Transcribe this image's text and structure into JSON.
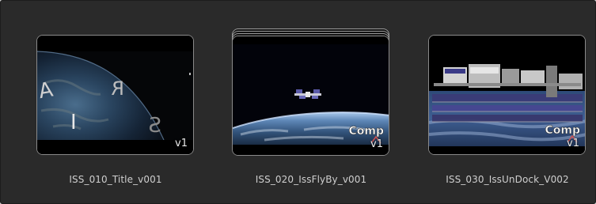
{
  "clips": [
    {
      "name": "ISS_010_Title_v001",
      "version": "v1",
      "type_badge": "",
      "thumbnail": "earth-title-thumbnail",
      "stacked": false
    },
    {
      "name": "ISS_020_IssFlyBy_v001",
      "version": "v1",
      "type_badge": "Comp",
      "thumbnail": "iss-flyby-thumbnail",
      "stacked": true
    },
    {
      "name": "ISS_030_IssUnDock_V002",
      "version": "v1",
      "type_badge": "Comp",
      "thumbnail": "iss-undock-thumbnail",
      "stacked": false
    }
  ],
  "title_letters": [
    "A",
    "R",
    "I",
    "S"
  ],
  "colors": {
    "panel_background": "#2a2a2a",
    "thumbnail_border": "#8a8a8a",
    "label_text": "#cfcfcf"
  }
}
